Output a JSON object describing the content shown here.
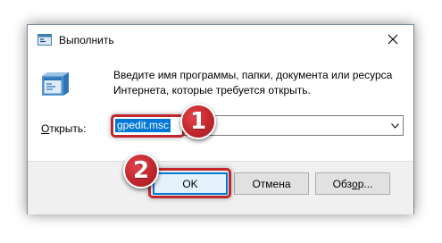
{
  "window": {
    "title": "Выполнить",
    "icon": "run-icon",
    "close_icon": "close-icon"
  },
  "description": {
    "line1": "Введите имя программы, папки, документа или ресурса",
    "line2": "Интернета, которые требуется открыть."
  },
  "open_field": {
    "label_underlined": "О",
    "label_rest": "ткрыть:",
    "value": "gpedit.msc",
    "dropdown_icon": "chevron-down-icon"
  },
  "buttons": {
    "ok": "OK",
    "cancel": "Отмена",
    "browse_before": "Обз",
    "browse_underlined": "о",
    "browse_after": "р..."
  },
  "annotations": {
    "step1": "1",
    "step2": "2",
    "color": "#c0272d"
  },
  "colors": {
    "selection": "#0078d7",
    "footer": "#f0f0f0"
  }
}
